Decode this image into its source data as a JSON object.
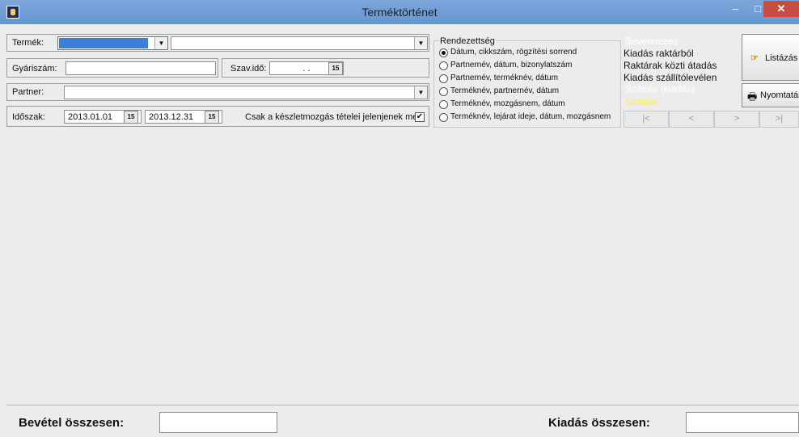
{
  "window": {
    "title": "Terméktörténet",
    "minimize": "–",
    "maximize": "□",
    "close": "✕"
  },
  "filters": {
    "termek_label": "Termék:",
    "termek_code": "",
    "termek_name": "",
    "gyariszam_label": "Gyáriszám:",
    "gyariszam_value": "",
    "szavido_label": "Szav.idő:",
    "szavido_value": ". .",
    "partner_label": "Partner:",
    "partner_value": "",
    "idoszak_label": "Időszak:",
    "date_from": "2013.01.01",
    "date_to": "2013.12.31",
    "calendar_glyph": "15",
    "only_stock_label": "Csak a készletmozgás tételei jelenjenek meg",
    "only_stock_checked": "✔"
  },
  "sort": {
    "title": "Rendezettség",
    "options": [
      "Dátum, cikkszám, rögzítési sorrend",
      "Partnernév, dátum, bizonylatszám",
      "Partnernév, terméknév, dátum",
      "Terméknév, partnernév, dátum",
      "Terméknév, mozgásnem, dátum",
      "Terméknév, lejárat ideje, dátum, mozgásnem"
    ],
    "selected_index": 0
  },
  "doc_types": {
    "bevetelezes": "Bevételezés",
    "kiadas_raktarbol": "Kiadás raktárból",
    "raktarak_kozti": "Raktárak közti átadás",
    "kiadas_szallito": "Kiadás szállítólevélen",
    "szamla_kiadas": "Számla (kiadás)",
    "szamla": "Számla"
  },
  "buttons": {
    "listazas": "Listázás",
    "nyomtatas": "Nyomtatás"
  },
  "nav": {
    "first": "|<",
    "prev": "<",
    "next": ">",
    "last": ">|"
  },
  "totals": {
    "bevetel_label": "Bevétel összesen:",
    "bevetel_value": "",
    "kiadas_label": "Kiadás összesen:",
    "kiadas_value": ""
  }
}
